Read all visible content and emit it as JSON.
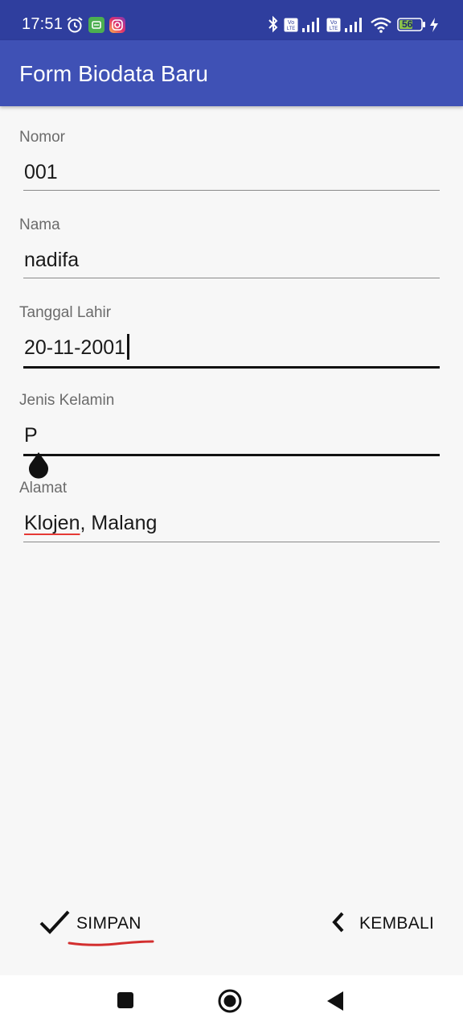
{
  "status_bar": {
    "time": "17:51",
    "icons": [
      "alarm-icon",
      "app-notification-icon",
      "instagram-icon",
      "bluetooth-icon",
      "volte-icon",
      "signal-icon",
      "volte-icon",
      "signal-icon",
      "wifi-icon",
      "battery-icon",
      "charging-icon"
    ],
    "battery_level": "56"
  },
  "app_bar": {
    "title": "Form Biodata Baru"
  },
  "form": {
    "fields": [
      {
        "label": "Nomor",
        "value": "001"
      },
      {
        "label": "Nama",
        "value": "nadifa"
      },
      {
        "label": "Tanggal Lahir",
        "value": "20-11-2001"
      },
      {
        "label": "Jenis Kelamin",
        "value": "P"
      },
      {
        "label": "Alamat",
        "value_misspelled": "Klojen",
        "value_rest": ", Malang"
      }
    ]
  },
  "actions": {
    "save_label": "SIMPAN",
    "save_icon": "check-icon",
    "back_label": "KEMBALI",
    "back_icon": "chevron-left-icon"
  },
  "nav_bar": {
    "icons": [
      "recents-icon",
      "home-icon",
      "back-icon"
    ]
  },
  "colors": {
    "status_bar": "#2f3e9e",
    "app_bar": "#3f51b5",
    "background": "#f7f7f7",
    "spell_error": "#e53935"
  }
}
